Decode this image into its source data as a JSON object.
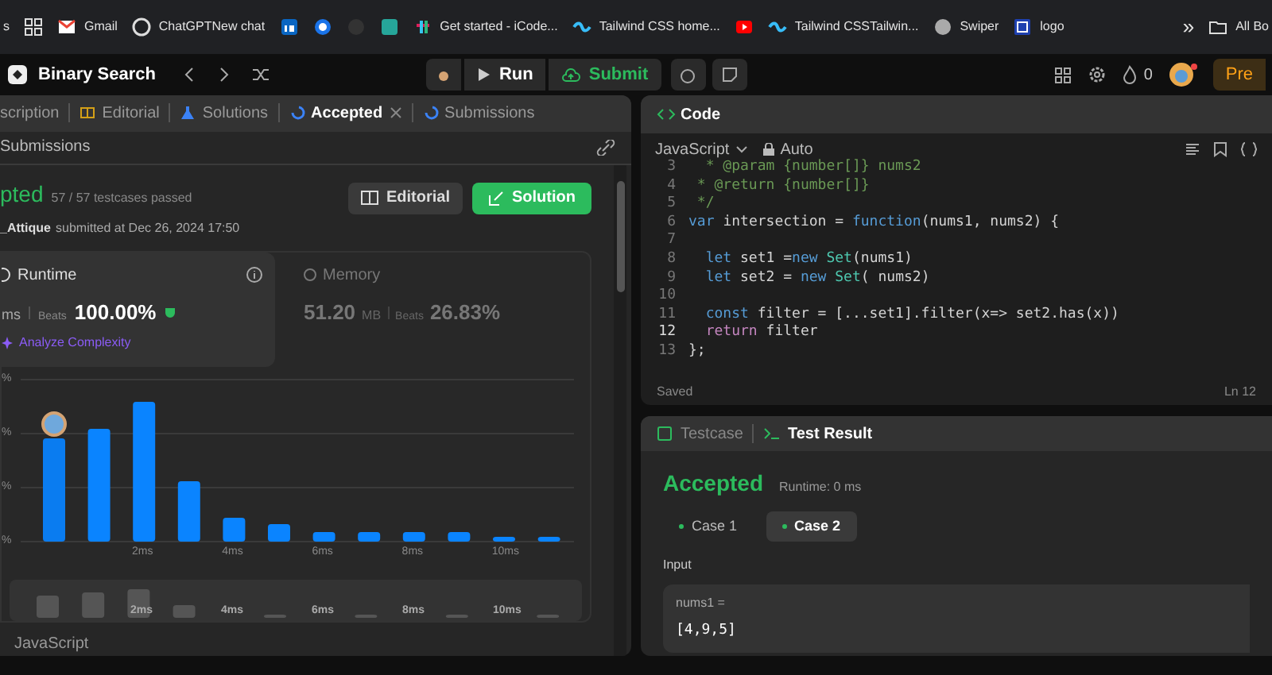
{
  "bookmarks": [
    {
      "kind": "text",
      "label": "s"
    },
    {
      "kind": "apps"
    },
    {
      "kind": "site",
      "label": "Gmail"
    },
    {
      "kind": "site",
      "label": "ChatGPTNew chat"
    },
    {
      "kind": "site"
    },
    {
      "kind": "site"
    },
    {
      "kind": "site"
    },
    {
      "kind": "site"
    },
    {
      "kind": "site",
      "label": "Get started - iCode..."
    },
    {
      "kind": "site",
      "label": "Tailwind CSS home..."
    },
    {
      "kind": "site"
    },
    {
      "kind": "site",
      "label": "Tailwind CSSTailwin..."
    },
    {
      "kind": "site",
      "label": "Swiper"
    },
    {
      "kind": "site",
      "label": "logo"
    },
    {
      "kind": "more",
      "label": "»"
    },
    {
      "kind": "folder",
      "label": "All Bo"
    }
  ],
  "nav": {
    "title": "Binary Search",
    "run": "Run",
    "submit": "Submit",
    "streak": "0",
    "premium": "Pre"
  },
  "left": {
    "tabs": [
      {
        "label": "scription",
        "selected": false
      },
      {
        "label": "Editorial",
        "selected": false
      },
      {
        "label": "Solutions",
        "selected": false
      },
      {
        "label": "Accepted",
        "selected": true
      },
      {
        "label": "Submissions",
        "selected": false
      }
    ],
    "sub_header": "Submissions",
    "status": "pted",
    "passed": "57 / 57 testcases passed",
    "user": "_Attique",
    "submitted": "submitted at Dec 26, 2024 17:50",
    "editorial_button": "Editorial",
    "solution_button": "Solution",
    "runtime": {
      "title": "Runtime",
      "unit": "ms",
      "beats_label": "Beats",
      "beats": "100.00%",
      "analyze": "Analyze Complexity"
    },
    "memory": {
      "title": "Memory",
      "value": "51.20",
      "unit": "MB",
      "beats_label": "Beats",
      "beats": "26.83%"
    },
    "chart": {
      "y_labels": [
        "%",
        "%",
        "%",
        "%"
      ],
      "x_labels": [
        "2ms",
        "4ms",
        "6ms",
        "8ms",
        "10ms"
      ]
    },
    "overview_labels": [
      "2ms",
      "4ms",
      "6ms",
      "8ms",
      "10ms"
    ],
    "language": "JavaScript"
  },
  "code": {
    "title": "Code",
    "language": "JavaScript",
    "mode": "Auto",
    "lines": [
      {
        "n": "3",
        "current": false,
        "tokens": [
          {
            "kind": "comment",
            "t": "  * @param {number[]} nums2"
          }
        ]
      },
      {
        "n": "4",
        "current": false,
        "tokens": [
          {
            "kind": "comment",
            "t": " * @return {number[]}"
          }
        ]
      },
      {
        "n": "5",
        "current": false,
        "tokens": [
          {
            "kind": "comment",
            "t": " */"
          }
        ]
      },
      {
        "n": "6",
        "current": false,
        "tokens": [
          {
            "kind": "keyword",
            "t": "var "
          },
          {
            "kind": "plain",
            "t": "intersection = "
          },
          {
            "kind": "keyword",
            "t": "function"
          },
          {
            "kind": "plain",
            "t": "(nums1, nums2) {"
          }
        ]
      },
      {
        "n": "7",
        "current": false
      },
      {
        "n": "8",
        "current": false,
        "tokens": [
          {
            "kind": "keyword",
            "t": "  let "
          },
          {
            "kind": "plain",
            "t": "set1 ="
          },
          {
            "kind": "keyword",
            "t": "new "
          },
          {
            "kind": "type",
            "t": "Set"
          },
          {
            "kind": "plain",
            "t": "(nums1)"
          }
        ]
      },
      {
        "n": "9",
        "current": false,
        "tokens": [
          {
            "kind": "keyword",
            "t": "  let "
          },
          {
            "kind": "plain",
            "t": "set2 = "
          },
          {
            "kind": "keyword",
            "t": "new "
          },
          {
            "kind": "type",
            "t": "Set"
          },
          {
            "kind": "plain",
            "t": "( nums2)"
          }
        ]
      },
      {
        "n": "10",
        "current": false
      },
      {
        "n": "11",
        "current": false,
        "tokens": [
          {
            "kind": "keyword",
            "t": "  const "
          },
          {
            "kind": "plain",
            "t": "filter = [...set1].filter(x=> set2.has(x))"
          }
        ]
      },
      {
        "n": "12",
        "current": true,
        "tokens": [
          {
            "kind": "control",
            "t": "  return "
          },
          {
            "kind": "plain",
            "t": "filter"
          }
        ]
      },
      {
        "n": "13",
        "current": false,
        "tokens": [
          {
            "kind": "plain",
            "t": "};"
          }
        ]
      }
    ],
    "saved": "Saved",
    "position": "Ln 12"
  },
  "result": {
    "tabs": [
      {
        "label": "Testcase",
        "selected": false
      },
      {
        "label": "Test Result",
        "selected": true
      }
    ],
    "status": "Accepted",
    "runtime": "Runtime: 0 ms",
    "cases": [
      {
        "label": "Case 1",
        "selected": false
      },
      {
        "label": "Case 2",
        "selected": true
      }
    ],
    "input_label": "Input",
    "param": "nums1 =",
    "value": "[4,9,5]"
  }
}
